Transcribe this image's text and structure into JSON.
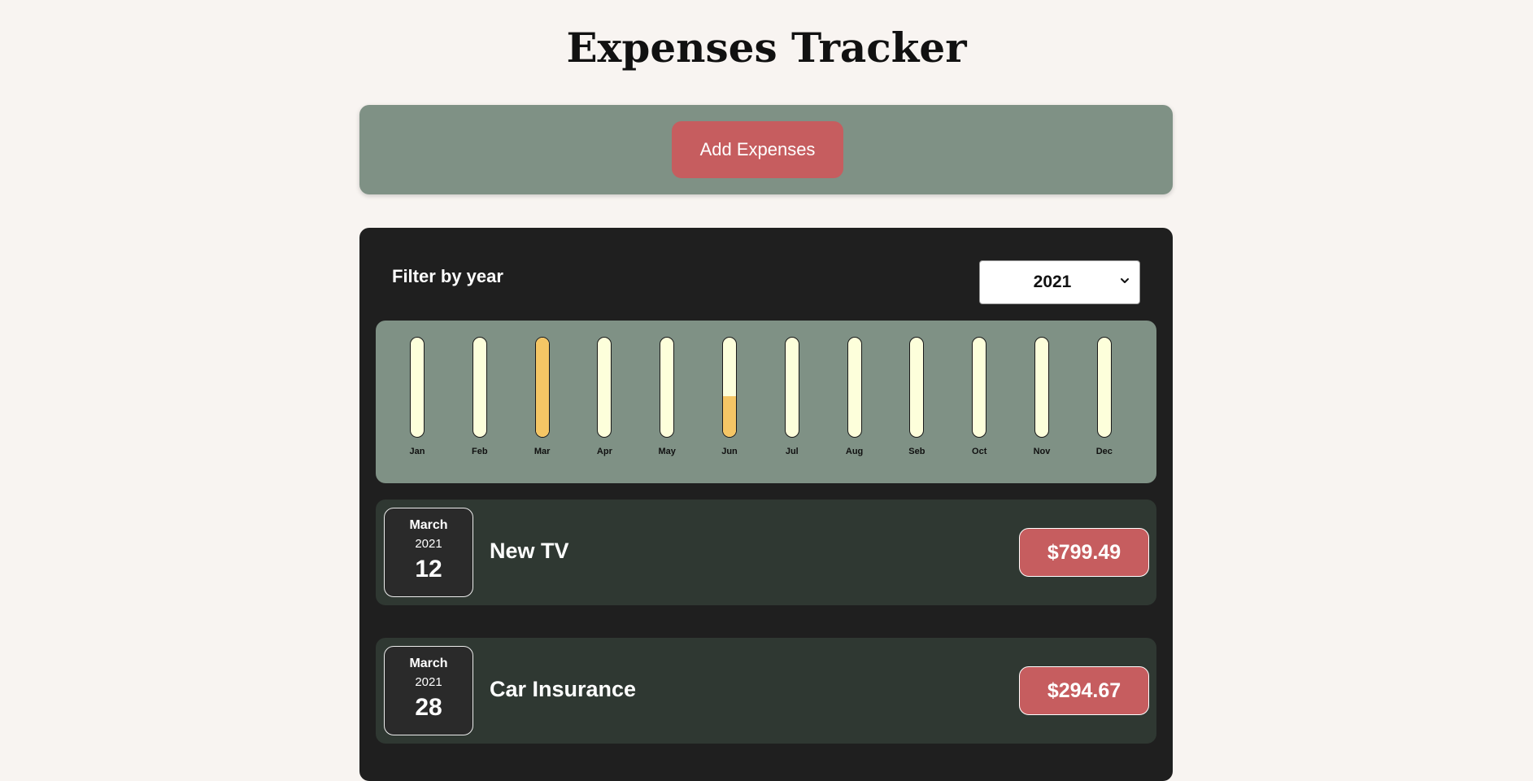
{
  "header": {
    "title": "Expenses Tracker"
  },
  "new_expense": {
    "add_label": "Add Expenses"
  },
  "filter": {
    "label": "Filter by year",
    "selected_year": "2021"
  },
  "colors": {
    "bar_empty": "#fdffdb",
    "bar_fill": "#f5c665",
    "accent_red": "#c65d5f",
    "panel_green": "#7f9185"
  },
  "icons": {
    "select_arrow": "chevron-down-icon"
  },
  "chart_data": {
    "type": "bar",
    "categories": [
      "Jan",
      "Feb",
      "Mar",
      "Apr",
      "May",
      "Jun",
      "Jul",
      "Aug",
      "Seb",
      "Oct",
      "Nov",
      "Dec"
    ],
    "fill_percent": [
      0,
      0,
      100,
      0,
      0,
      41,
      0,
      0,
      0,
      0,
      0,
      0
    ]
  },
  "expenses": [
    {
      "month": "March",
      "year": "2021",
      "day": "12",
      "title": "New TV",
      "amount": "$799.49"
    },
    {
      "month": "March",
      "year": "2021",
      "day": "28",
      "title": "Car Insurance",
      "amount": "$294.67"
    }
  ]
}
